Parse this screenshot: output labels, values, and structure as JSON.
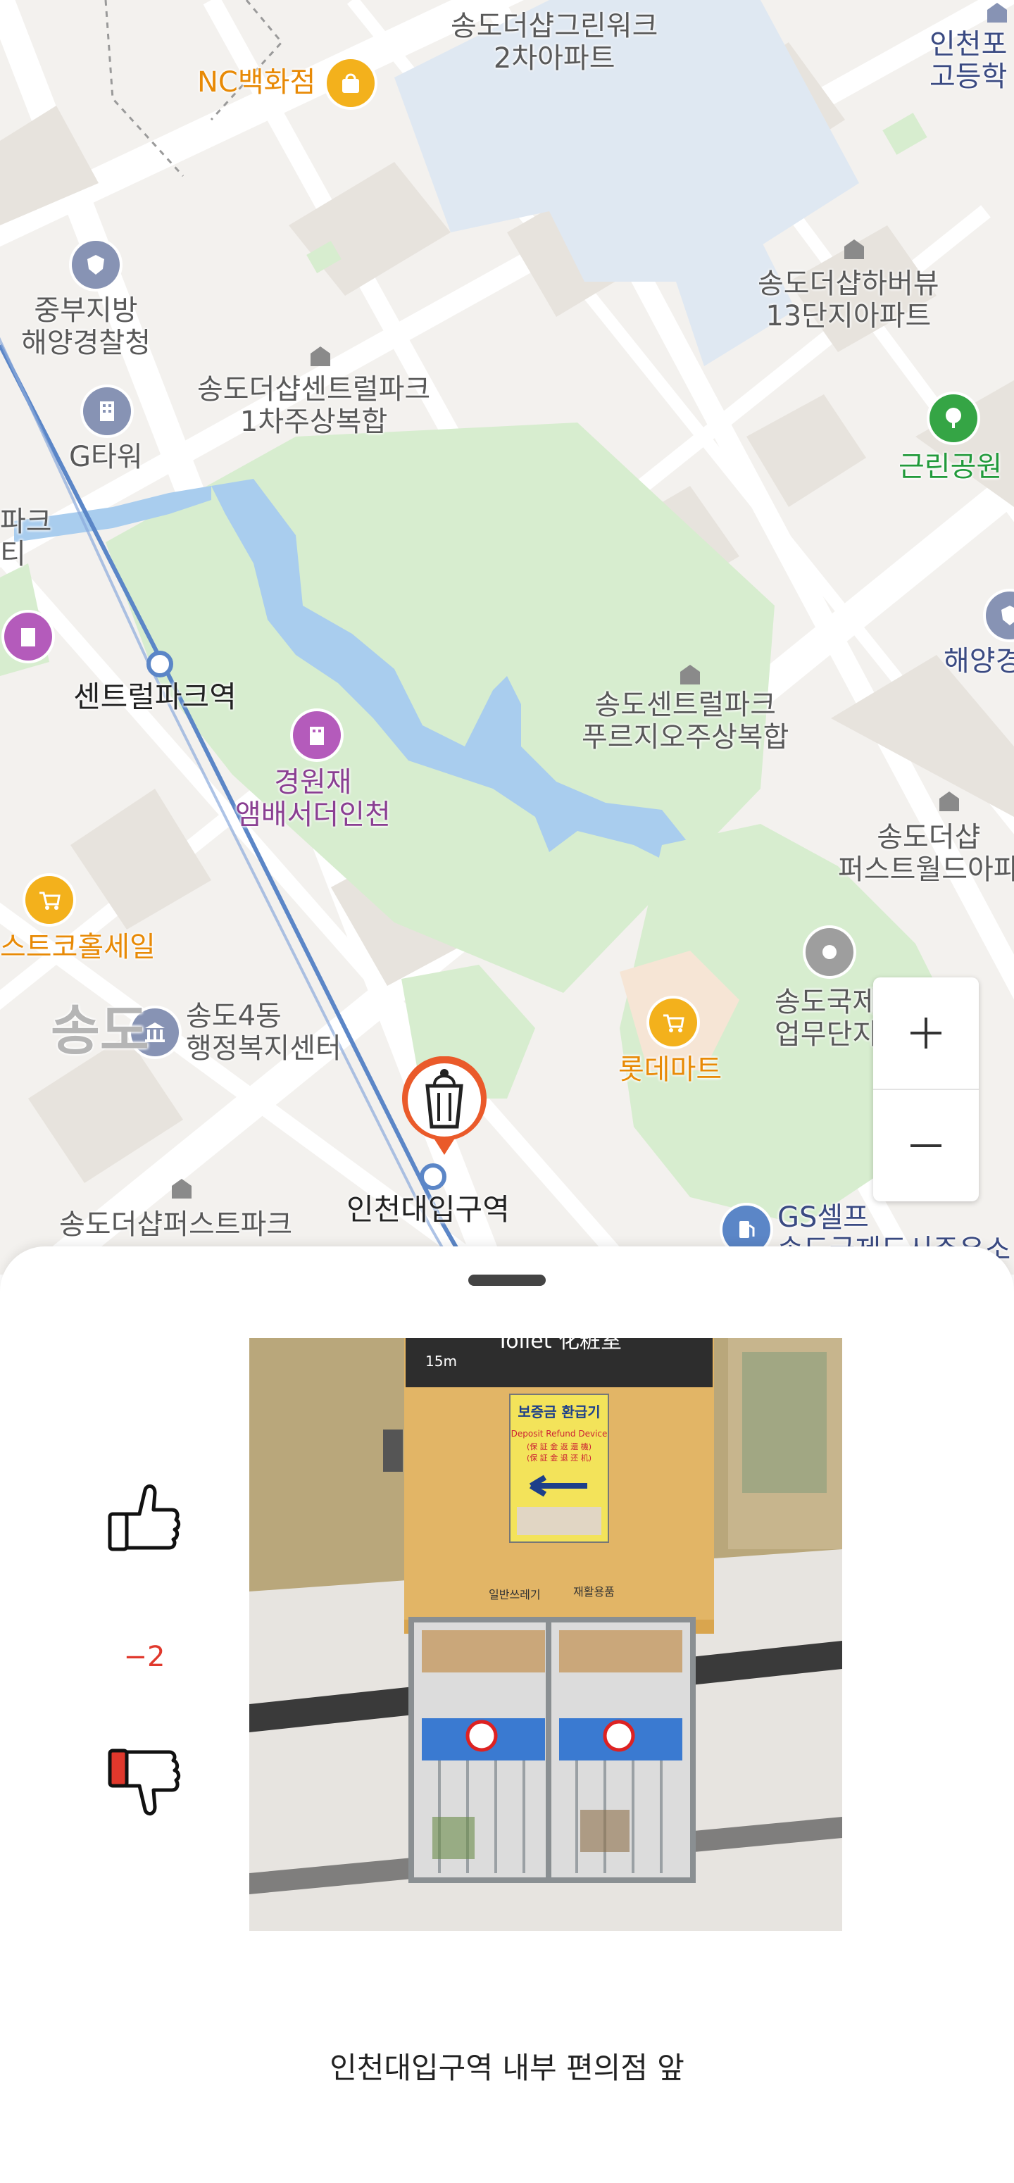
{
  "map": {
    "labels": {
      "nc_dept": "NC백화점",
      "songdo_greenwork_2": "송도더샵그린워크\n2차아파트",
      "incheon_po_high": "인천포\n고등학",
      "coast_guard": "중부지방\n해양경찰청",
      "central_park_1": "송도더샵센트럴파크\n1차주상복합",
      "harbor_view_13": "송도더샵하버뷰\n13단지아파트",
      "neighborhood_park": "근린공원",
      "g_tower": "G타워",
      "park_left_edge": "파크\n티",
      "central_park_station": "센트럴파크역",
      "coast_guard_right": "해양경",
      "gyeongwonjae": "경원재\n앰배서더인천",
      "prugio": "송도센트럴파크\n푸르지오주상복합",
      "first_world": "송도더샵\n퍼스트월드아파",
      "costco": "스트코홀세일",
      "district": "송도",
      "songdo4_center": "송도4동\n행정복지센터",
      "lotte_mart": "롯데마트",
      "intl_business": "송도국제\n업무단지",
      "incheon_univ_station": "인천대입구역",
      "first_park": "송도더샵퍼스트파크",
      "gs_self": "GS셀프",
      "gs_self_sub": "송도국제도시주유소"
    },
    "icons": {
      "shopping": "shopping-bag-icon",
      "police": "police-icon",
      "office": "office-building-icon",
      "tree": "tree-icon",
      "hotel": "hotel-icon",
      "cart": "cart-icon",
      "government": "government-icon",
      "fuel": "fuel-icon",
      "trash_pin": "trash-bin-icon"
    },
    "colors": {
      "park": "#d7edcf",
      "water": "#a9cdee",
      "road": "#ffffff",
      "block": "#e9e5e0",
      "subway": "#5b86c7",
      "orange": "#e88a06",
      "purple": "#b45bbb",
      "pin": "#ea5a2a"
    },
    "zoom": {
      "in_label": "+",
      "out_label": "−"
    }
  },
  "sheet": {
    "score": "−2",
    "caption": "인천대입구역 내부 편의점 앞",
    "photo_signs": {
      "top_banner": "Toilet 化粧室",
      "distance": "15m",
      "device_title": "보증금 환급기",
      "device_en": "Deposit Refund Device",
      "device_cn1": "(保 証 金 返 還 機)",
      "device_cn2": "(保 証 金 退 还 机)",
      "bin_general": "일반쓰레기",
      "bin_recycle": "재활용품"
    },
    "icons": {
      "up": "thumbs-up-icon",
      "down": "thumbs-down-icon"
    },
    "colors": {
      "score": "#e0382c",
      "thumb_down_fill": "#e0382c"
    }
  }
}
